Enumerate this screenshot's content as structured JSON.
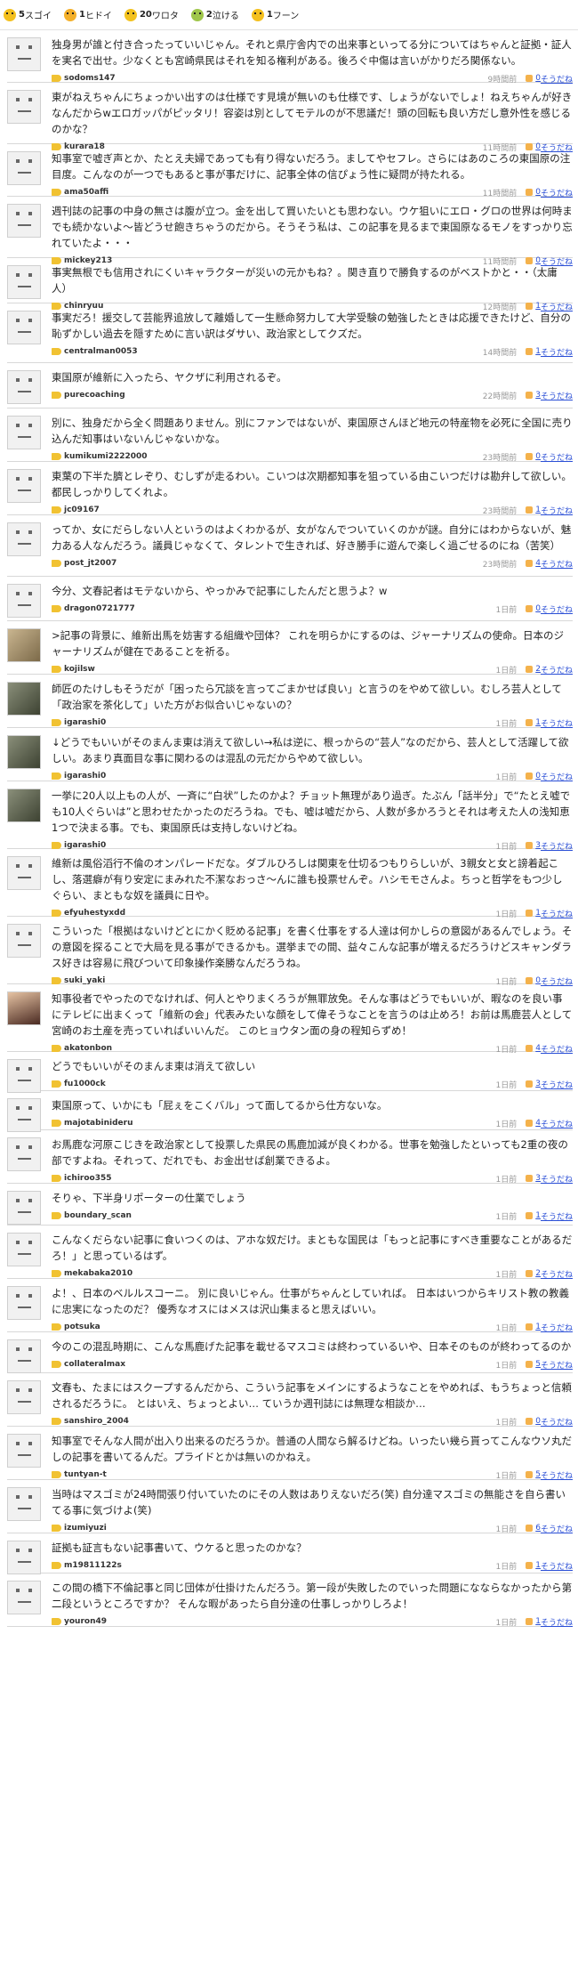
{
  "reactions": [
    {
      "icon": "surprised-face-icon",
      "color": "#f4c01e",
      "count": "5",
      "label": "スゴイ"
    },
    {
      "icon": "angry-face-icon",
      "color": "#f4b02a",
      "count": "1",
      "label": "ヒドイ"
    },
    {
      "icon": "laughing-face-icon",
      "color": "#f3c21e",
      "count": "20",
      "label": "ワロタ"
    },
    {
      "icon": "crying-face-icon",
      "color": "#9fc64a",
      "count": "2",
      "label": "泣ける"
    },
    {
      "icon": "meh-face-icon",
      "color": "#f4c01e",
      "count": "1",
      "label": "フーン"
    }
  ],
  "comments": [
    {
      "avatar": "default",
      "text": "独身男が誰と付き合ったっていいじゃん。それと県庁舎内での出来事といってる分についてはちゃんと証拠・証人を実名で出せ。少なくとも宮崎県民はそれを知る権利がある。後ろぐ中傷は言いがかりだろ関係ない。",
      "user": "sodoms147",
      "time": "9時間前",
      "likes": "0",
      "like_label": "そうだね"
    },
    {
      "avatar": "default",
      "text": "東がねえちゃんにちょっかい出すのは仕様です見境が無いのも仕様です、しょうがないでしょ！ねえちゃんが好きなんだからwエロガッパがピッタリ！容姿は別としてモテルのが不思議だ！頭の回転も良い方だし意外性を感じるのかな？",
      "user": "kurara18",
      "time": "11時間前",
      "likes": "0",
      "like_label": "そうだね"
    },
    {
      "avatar": "default",
      "text": "知事室で嘘ぎ声とか、たとえ夫婦であっても有り得ないだろう。ましてやセフレ。さらにはあのころの東国原の注目度。こんなのが一つでもあると事が事だけに、記事全体の信ぴょう性に疑問が持たれる。",
      "user": "ama50affi",
      "time": "11時間前",
      "likes": "0",
      "like_label": "そうだね"
    },
    {
      "avatar": "default",
      "text": "週刊誌の記事の中身の無さは腹が立つ。金を出して買いたいとも思わない。ウケ狙いにエロ・グロの世界は何時までも続かないよ〜皆どうせ飽きちゃうのだから。そうそう私は、この記事を見るまで東国原なるモノをすっかり忘れていたよ・・・",
      "user": "mickey213",
      "time": "11時間前",
      "likes": "0",
      "like_label": "そうだね"
    },
    {
      "avatar": "default",
      "text": "事実無根でも信用されにくいキャラクターが災いの元かもね？。関き直りで勝負するのがベストかと・・（太庸人）",
      "user": "chinryuu",
      "time": "12時間前",
      "likes": "1",
      "like_label": "そうだね"
    },
    {
      "avatar": "default",
      "text": "事実だろ！援交して芸能界追放して離婚して一生懸命努力して大学受験の勉強したときは応援できたけど、自分の恥ずかしい過去を隠すために言い訳はダサい、政治家としてクズだ。",
      "user": "centralman0053",
      "time": "14時間前",
      "likes": "1",
      "like_label": "そうだね"
    },
    {
      "avatar": "default",
      "text": "東国原が維新に入ったら、ヤクザに利用されるぞ。",
      "user": "purecoaching",
      "time": "22時間前",
      "likes": "3",
      "like_label": "そうだね"
    },
    {
      "avatar": "default",
      "text": "別に、独身だから全く問題ありません。別にファンではないが、東国原さんほど地元の特産物を必死に全国に売り込んだ知事はいないんじゃないかな。",
      "user": "kumikumi2222000",
      "time": "23時間前",
      "likes": "0",
      "like_label": "そうだね"
    },
    {
      "avatar": "default",
      "text": "東葉の下半た臍とレぞり、むしずが走るわい。こいつは次期都知事を狙っている由こいつだけは勘弁して欲しい。都民しっかりしてくれよ。",
      "user": "jc09167",
      "time": "23時間前",
      "likes": "1",
      "like_label": "そうだね"
    },
    {
      "avatar": "default",
      "text": "ってか、女にだらしない人というのはよくわかるが、女がなんでついていくのかが謎。自分にはわからないが、魅力ある人なんだろう。議員じゃなくて、タレントで生きれば、好き勝手に遊んで楽しく過ごせるのにね（苦笑）",
      "user": "post_jt2007",
      "time": "23時間前",
      "likes": "4",
      "like_label": "そうだね"
    },
    {
      "avatar": "default",
      "text": "今分、文春記者はモテないから、やっかみで記事にしたんだと思うよ？w",
      "user": "dragon0721777",
      "time": "1日前",
      "likes": "0",
      "like_label": "そうだね"
    },
    {
      "avatar": "dog",
      "text": ">記事の背景に、維新出馬を妨害する組織や団体？ これを明らかにするのは、ジャーナリズムの使命。日本のジャーナリズムが健在であることを祈る。",
      "user": "kojilsw",
      "time": "1日前",
      "likes": "2",
      "like_label": "そうだね"
    },
    {
      "avatar": "wolf",
      "text": "師匠のたけしもそうだが「困ったら冗談を言ってごまかせば良い」と言うのをやめて欲しい。むしろ芸人として「政治家を茶化して」いた方がお似合いじゃないの？",
      "user": "igarashi0",
      "time": "1日前",
      "likes": "1",
      "like_label": "そうだね"
    },
    {
      "avatar": "wolf",
      "text": "↓どうでもいいがそのまんま東は消えて欲しい→私は逆に、根っからの“芸人”なのだから、芸人として活躍して欲しい。あまり真面目な事に関わるのは混乱の元だからやめて欲しい。",
      "user": "igarashi0",
      "time": "1日前",
      "likes": "0",
      "like_label": "そうだね"
    },
    {
      "avatar": "wolf",
      "text": "一挙に20人以上もの人が、一斉に“白状”したのかよ？チョット無理があり過ぎ。たぶん「話半分」で“たとえ嘘でも10人ぐらいは”と思わせたかったのだろうね。でも、嘘は嘘だから、人数が多かろうとそれは考えた人の浅知恵1つで決まる事。でも、東国原氏は支持しないけどね。",
      "user": "igarashi0",
      "time": "1日前",
      "likes": "3",
      "like_label": "そうだね"
    },
    {
      "avatar": "default",
      "text": "維新は風俗滔行不倫のオンパレードだな。ダブルひろしは関東を仕切るつもりらしいが、3親女と女と謗着起こし、落選癖が有り安定にまみれた不潔なおっさ〜んに誰も投票せんぞ。ハシモモさんよ。ちっと哲学をもつ少しぐらい、まともな奴を議員に日や。",
      "user": "efyuhestyxdd",
      "time": "1日前",
      "likes": "1",
      "like_label": "そうだね"
    },
    {
      "avatar": "default",
      "text": "こういった「根拠はないけどとにかく貶める記事」を書く仕事をする人達は何かしらの意図があるんでしょう。その意図を探ることで大局を見る事ができるかも。選挙までの間、益々こんな記事が増えるだろうけどスキャンダラス好きは容易に飛びついて印象操作楽勝なんだろうね。",
      "user": "suki_yaki",
      "time": "1日前",
      "likes": "0",
      "like_label": "そうだね"
    },
    {
      "avatar": "girl",
      "text": "知事役者でやったのでなければ、何人とやりまくろうが無罪放免。そんな事はどうでもいいが、暇なのを良い事にテレビに出まくって「維新の会」代表みたいな顔をして偉そうなことを言うのは止めろ！お前は馬鹿芸人として宮崎のお土産を売っていればいいんだ。 このヒョウタン面の身の程知らずめ！",
      "user": "akatonbon",
      "time": "1日前",
      "likes": "4",
      "like_label": "そうだね"
    },
    {
      "avatar": "default",
      "text": "どうでもいいがそのまんま東は消えて欲しい",
      "user": "fu1000ck",
      "time": "1日前",
      "likes": "3",
      "like_label": "そうだね"
    },
    {
      "avatar": "default",
      "text": "東国原って、いかにも「屁ぇをこくバル」って面してるから仕方ないな。",
      "user": "majotabinideru",
      "time": "1日前",
      "likes": "4",
      "like_label": "そうだね"
    },
    {
      "avatar": "default",
      "text": "お馬鹿な河原こじきを政治家として投票した県民の馬鹿加減が良くわかる。世事を勉強したといっても2重の夜の部ですよね。それって、だれでも、お金出せば創業できるよ。",
      "user": "ichiroo355",
      "time": "1日前",
      "likes": "3",
      "like_label": "そうだね"
    },
    {
      "avatar": "default",
      "text": "そりゃ、下半身リポーターの仕業でしょう",
      "user": "boundary_scan",
      "time": "1日前",
      "likes": "1",
      "like_label": "そうだね"
    },
    {
      "avatar": "default",
      "text": "こんなくだらない記事に食いつくのは、アホな奴だけ。まともな国民は「もっと記事にすべき重要なことがあるだろ！」と思っているはず。",
      "user": "mekabaka2010",
      "time": "1日前",
      "likes": "2",
      "like_label": "そうだね"
    },
    {
      "avatar": "default",
      "text": "よ！、日本のベルルスコーニ。 別に良いじゃん。仕事がちゃんとしていれば。 日本はいつからキリスト教の教義に忠実になったのだ？ 優秀なオスにはメスは沢山集まると思えばいい。",
      "user": "potsuka",
      "time": "1日前",
      "likes": "1",
      "like_label": "そうだね"
    },
    {
      "avatar": "default",
      "text": "今のこの混乱時期に、こんな馬鹿げた記事を載せるマスコミは終わっているいや、日本そのものが終わってるのか",
      "user": "collateralmax",
      "time": "1日前",
      "likes": "5",
      "like_label": "そうだね"
    },
    {
      "avatar": "default",
      "text": "文春も、たまにはスクープするんだから、こういう記事をメインにするようなことをやめれば、もうちょっと信頼されるだろうに。 とはいえ、ちょっとよい… ていうか週刊誌には無理な相談か…",
      "user": "sanshiro_2004",
      "time": "1日前",
      "likes": "0",
      "like_label": "そうだね"
    },
    {
      "avatar": "default",
      "text": "知事室でそんな人間が出入り出来るのだろうか。普通の人間なら解るけどね。いったい幾ら貰ってこんなウソ丸だしの記事を書いてるんだ。プライドとかは無いのかねえ。",
      "user": "tuntyan-t",
      "time": "1日前",
      "likes": "5",
      "like_label": "そうだね"
    },
    {
      "avatar": "default",
      "text": "当時はマスゴミが24時間張り付いていたのにその人数はありえないだろ(笑) 自分達マスゴミの無能さを自ら書いてる事に気づけよ(笑)",
      "user": "izumiyuzi",
      "time": "1日前",
      "likes": "6",
      "like_label": "そうだね"
    },
    {
      "avatar": "default",
      "text": "証拠も証言もない記事書いて、ウケると思ったのかな？",
      "user": "m19811122s",
      "time": "1日前",
      "likes": "1",
      "like_label": "そうだね"
    },
    {
      "avatar": "default",
      "text": "この間の橋下不倫記事と同じ団体が仕掛けたんだろう。第一段が失敗したのでいった問題になならなかったから第二段というところですか？ そんな暇があったら自分達の仕事しっかりしろよ！",
      "user": "youron49",
      "time": "1日前",
      "likes": "1",
      "like_label": "そうだね"
    }
  ]
}
